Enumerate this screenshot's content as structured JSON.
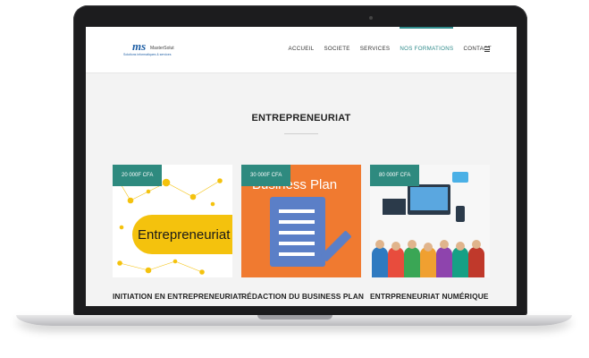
{
  "header": {
    "logo": {
      "mark": "ms",
      "name": "MasterSolut",
      "tagline": "Solutions informatiques & services"
    },
    "nav": [
      {
        "label": "ACCUEIL",
        "active": false
      },
      {
        "label": "SOCIETE",
        "active": false
      },
      {
        "label": "SERVICES",
        "active": false
      },
      {
        "label": "NOS FORMATIONS",
        "active": true
      },
      {
        "label": "CONTACT",
        "active": false
      }
    ],
    "menu_icon": "hamburger-icon"
  },
  "section": {
    "title": "ENTREPRENEURIAT"
  },
  "cards": [
    {
      "price": "20 000F CFA",
      "image_text": "Entrepreneuriat",
      "title": "INITIATION EN ENTREPRENEURIAT"
    },
    {
      "price": "30 000F CFA",
      "image_text": "Business Plan",
      "title": "RÉDACTION DU BUSINESS PLAN"
    },
    {
      "price": "80 000F CFA",
      "image_text": "",
      "title": "ENTRPRENEURIAT NUMÉRIQUE"
    }
  ],
  "colors": {
    "accent": "#2e8a7f",
    "nav_active": "#2e8a8a",
    "brand_blue": "#1f5fa5",
    "banner_yellow": "#f4c20d",
    "card2_orange": "#f07a30"
  }
}
